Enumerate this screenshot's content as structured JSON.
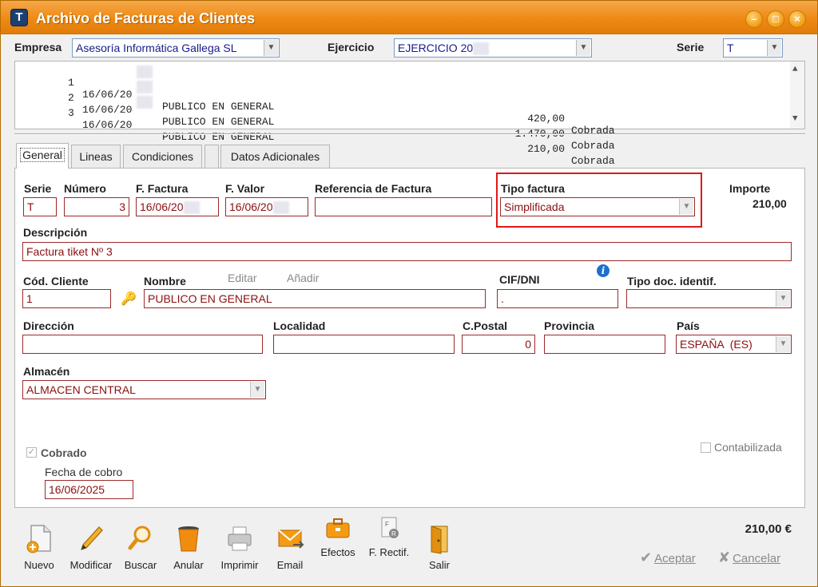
{
  "window": {
    "title": "Archivo de Facturas de Clientes",
    "app_icon_glyph": "T",
    "controls": {
      "minimize": "–",
      "maximize": "□",
      "close": "×"
    }
  },
  "header": {
    "empresa_label": "Empresa",
    "empresa_value": "Asesoría Informática Gallega SL",
    "ejercicio_label": "Ejercicio",
    "ejercicio_value": "EJERCICIO 20",
    "serie_label": "Serie",
    "serie_value": "T"
  },
  "invoice_list": [
    {
      "num": "1",
      "date": "16/06/20",
      "client": "PUBLICO EN GENERAL",
      "amount": "420,00",
      "status": "Cobrada"
    },
    {
      "num": "2",
      "date": "16/06/20",
      "client": "PUBLICO EN GENERAL",
      "amount": "1.470,00",
      "status": "Cobrada"
    },
    {
      "num": "3",
      "date": "16/06/20",
      "client": "PUBLICO EN GENERAL",
      "amount": "210,00",
      "status": "Cobrada"
    }
  ],
  "tabs": [
    {
      "label": "General",
      "active": true
    },
    {
      "label": "Lineas",
      "active": false
    },
    {
      "label": "Condiciones",
      "active": false
    },
    {
      "label": "",
      "active": false
    },
    {
      "label": "Datos Adicionales",
      "active": false
    }
  ],
  "form": {
    "serie_label": "Serie",
    "serie_value": "T",
    "numero_label": "Número",
    "numero_value": "3",
    "f_factura_label": "F. Factura",
    "f_factura_value": "16/06/20",
    "f_valor_label": "F. Valor",
    "f_valor_value": "16/06/20",
    "referencia_label": "Referencia de Factura",
    "referencia_value": "",
    "tipo_factura_label": "Tipo factura",
    "tipo_factura_value": "Simplificada",
    "importe_label": "Importe",
    "importe_value": "210,00",
    "descripcion_label": "Descripción",
    "descripcion_value": "Factura tiket Nº 3",
    "cod_cliente_label": "Cód. Cliente",
    "cod_cliente_value": "1",
    "nombre_label": "Nombre",
    "nombre_value": "PUBLICO EN GENERAL",
    "editar_link": "Editar",
    "anadir_link": "Añadir",
    "cif_label": "CIF/DNI",
    "cif_value": ".",
    "tipo_doc_label": "Tipo doc. identif.",
    "tipo_doc_value": "",
    "direccion_label": "Dirección",
    "direccion_value": "",
    "localidad_label": "Localidad",
    "localidad_value": "",
    "cpostal_label": "C.Postal",
    "cpostal_value": "0",
    "provincia_label": "Provincia",
    "provincia_value": "",
    "pais_label": "País",
    "pais_value": "ESPAÑA  (ES)",
    "almacen_label": "Almacén",
    "almacen_value": "ALMACEN CENTRAL",
    "cobrado_label": "Cobrado",
    "cobrado_checked": true,
    "fecha_cobro_label": "Fecha de cobro",
    "fecha_cobro_value": "16/06/2025",
    "contabilizada_label": "Contabilizada",
    "contabilizada_checked": false
  },
  "toolbar": {
    "nuevo": "Nuevo",
    "modificar": "Modificar",
    "buscar": "Buscar",
    "anular": "Anular",
    "imprimir": "Imprimir",
    "email": "Email",
    "efectos": "Efectos",
    "f_rectif": "F. Rectif.",
    "salir": "Salir"
  },
  "footer": {
    "total": "210,00 €",
    "aceptar": "Aceptar",
    "cancelar": "Cancelar"
  },
  "colors": {
    "title_bar": "#ee8a14",
    "field_border": "#9c2a2a",
    "field_text": "#8b0f0f",
    "highlight_box": "#e01818",
    "combo_border": "#7a9cc6"
  }
}
